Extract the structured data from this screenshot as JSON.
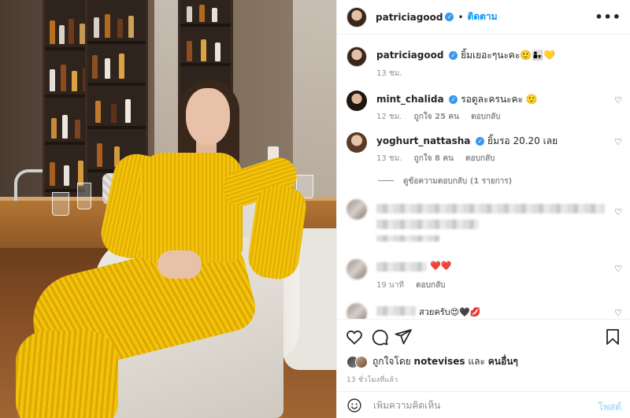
{
  "header": {
    "username": "patriciagood",
    "verified_mark": "✓",
    "separator": "•",
    "follow_label": "ติดตาม",
    "more_icon": "more-horizontal-icon",
    "more_label": "•••"
  },
  "caption": {
    "username": "patriciagood",
    "text": "ยิ้มเยอะๆนะคะ🙂👩‍👧💛",
    "time": "13 ชม."
  },
  "comments": [
    {
      "username": "mint_chalida",
      "text": "รอดูละครนะคะ 🙂",
      "time": "12 ชม.",
      "likes": "ถูกใจ 25 คน",
      "reply": "ตอบกลับ"
    },
    {
      "username": "yoghurt_nattasha",
      "text": "ยิ้มรอ 20.20 เลย",
      "time": "13 ชม.",
      "likes": "ถูกใจ 8 คน",
      "reply": "ตอบกลับ"
    }
  ],
  "view_replies": "ดูข้อความตอบกลับ (1 รายการ)",
  "blurred_comments": [
    {
      "text": "❤️❤️",
      "time": "19 นาที",
      "reply": "ตอบกลับ"
    },
    {
      "text": "สวยครับ😍🖤💋"
    }
  ],
  "liked_by": {
    "prefix": "ถูกใจโดย",
    "user": "notevises",
    "joiner": "และ",
    "others": "คนอื่นๆ"
  },
  "timestamp": "13 ชั่วโมงที่แล้ว",
  "add_comment": {
    "placeholder": "เพิ่มความคิดเห็น",
    "post_label": "โพสต์"
  },
  "colors": {
    "accent": "#0095f6",
    "verified": "#3897f0",
    "muted": "#8e8e8e",
    "post_disabled": "#b2dffc"
  }
}
